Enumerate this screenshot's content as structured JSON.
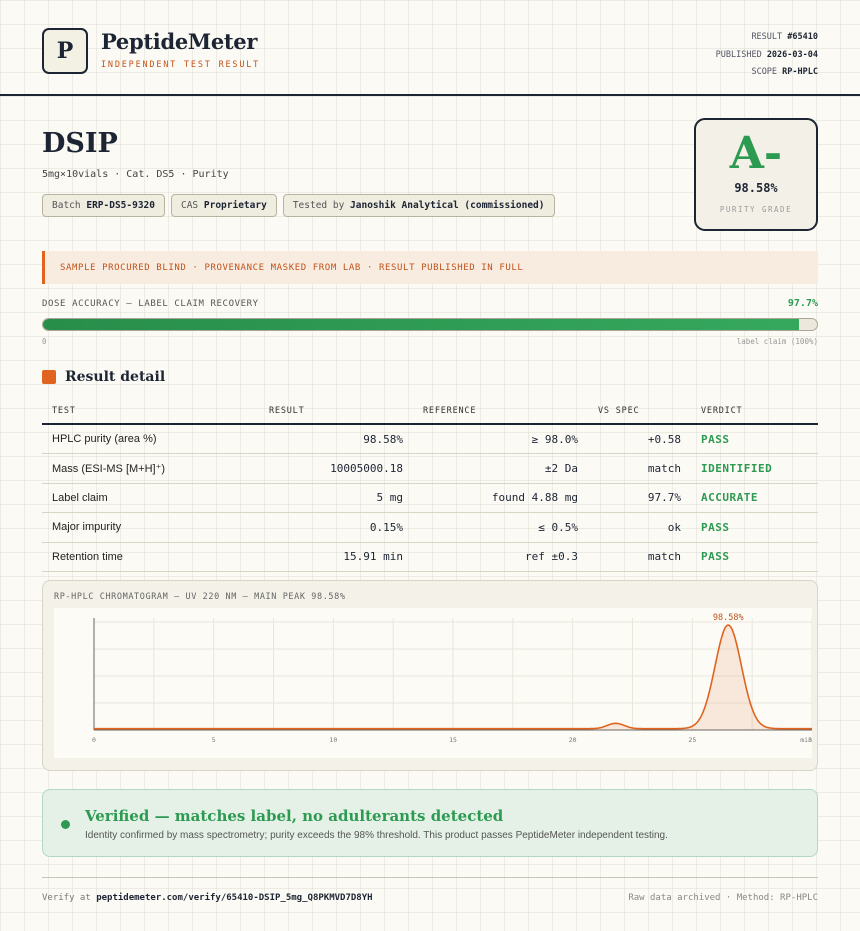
{
  "brand": {
    "logo_letter": "P",
    "name": "PeptideMeter",
    "tagline": "INDEPENDENT TEST RESULT"
  },
  "meta": {
    "result_label": "RESULT",
    "result_value": "#65410",
    "published_label": "PUBLISHED",
    "published_value": "2026-03-04",
    "scope_label": "SCOPE",
    "scope_value": "RP-HPLC"
  },
  "product": {
    "name": "DSIP",
    "subtitle": "5mg×10vials · Cat. DS5 · Purity",
    "chips": [
      {
        "label": "Batch",
        "value": "ERP-DS5-9320"
      },
      {
        "label": "CAS",
        "value": "Proprietary"
      },
      {
        "label": "Tested by",
        "value": "Janoshik Analytical (commissioned)"
      }
    ]
  },
  "grade": {
    "letter": "A-",
    "percent": "98.58%",
    "label": "PURITY GRADE"
  },
  "notice": "SAMPLE PROCURED BLIND · PROVENANCE MASKED FROM LAB · RESULT PUBLISHED IN FULL",
  "dose": {
    "label": "DOSE ACCURACY — LABEL CLAIM RECOVERY",
    "value_text": "97.7%",
    "fill_percent": 97.7,
    "min_label": "0",
    "max_label": "label claim (100%)"
  },
  "results": {
    "title": "Result detail",
    "headers": [
      "TEST",
      "RESULT",
      "REFERENCE",
      "VS SPEC",
      "VERDICT"
    ],
    "rows": [
      {
        "test": "HPLC purity (area %)",
        "result": "98.58%",
        "reference": "≥ 98.0%",
        "vs_spec": "+0.58",
        "verdict": "PASS"
      },
      {
        "test": "Mass (ESI-MS [M+H]⁺)",
        "result": "10005000.18",
        "reference": "±2 Da",
        "vs_spec": "match",
        "verdict": "IDENTIFIED"
      },
      {
        "test": "Label claim",
        "result": "5 mg",
        "reference": "found 4.88 mg",
        "vs_spec": "97.7%",
        "verdict": "ACCURATE"
      },
      {
        "test": "Major impurity",
        "result": "0.15%",
        "reference": "≤ 0.5%",
        "vs_spec": "ok",
        "verdict": "PASS"
      },
      {
        "test": "Retention time",
        "result": "15.91 min",
        "reference": "ref ±0.3",
        "vs_spec": "match",
        "verdict": "PASS"
      }
    ]
  },
  "chromatogram": {
    "title": "RP-HPLC CHROMATOGRAM — UV 220 NM — MAIN PEAK 98.58%",
    "peak_label": "98.58%",
    "line_color": "#e06420"
  },
  "chart_data": {
    "type": "line",
    "title": "RP-HPLC CHROMATOGRAM — UV 220 NM — MAIN PEAK 98.58%",
    "xlabel": "",
    "ylabel": "",
    "x_ticks": [
      "0",
      "5",
      "10",
      "15",
      "20",
      "25",
      "30"
    ],
    "x_tick_suffix": "min",
    "xlim": [
      0,
      30
    ],
    "ylim": [
      0,
      100
    ],
    "baseline": 1.2,
    "peaks": [
      {
        "x": 21.8,
        "height": 5,
        "width": 0.35
      },
      {
        "x": 26.5,
        "height": 96,
        "width": 0.55
      }
    ],
    "annotations": [
      {
        "x": 26.5,
        "text": "98.58%"
      }
    ],
    "grid": true
  },
  "verification": {
    "title": "Verified — matches label, no adulterants detected",
    "text": "Identity confirmed by mass spectrometry; purity exceeds the 98% threshold. This product passes PeptideMeter independent testing."
  },
  "footer": {
    "verify_prefix": "Verify at",
    "verify_url": "peptidemeter.com/verify/65410-DSIP_5mg_Q8PKMVD7D8YH",
    "right_text": "Raw data archived · Method: RP-HPLC"
  },
  "colors": {
    "accent": "#e06420",
    "pass_green": "#2d9a52",
    "ink": "#1d2433"
  }
}
